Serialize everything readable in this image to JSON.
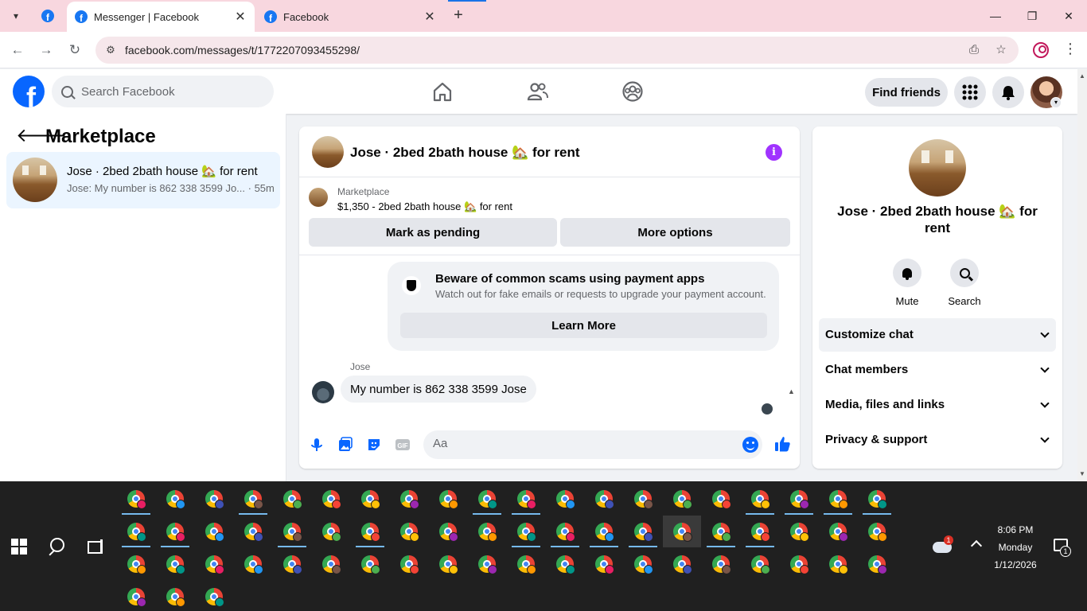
{
  "browser": {
    "tabs": [
      {
        "title": "Messenger | Facebook",
        "active": true
      },
      {
        "title": "Facebook",
        "active": false
      }
    ],
    "url": "facebook.com/messages/t/1772207093455298/"
  },
  "header": {
    "search_placeholder": "Search Facebook",
    "find_friends": "Find friends"
  },
  "sidebar": {
    "title": "Marketplace",
    "conversations": [
      {
        "name": "Jose · 2bed 2bath house 🏡 for rent",
        "snippet": "Jose: My number is 862 338 3599 Jo... · 55m"
      }
    ]
  },
  "chat": {
    "title": "Jose · 2bed 2bath house 🏡 for rent",
    "listing_label": "Marketplace",
    "listing_desc": "$1,350 - 2bed 2bath house 🏡 for rent",
    "mark_pending": "Mark as pending",
    "more_options": "More options",
    "scam_title": "Beware of common scams using payment apps",
    "scam_sub": "Watch out for fake emails or requests to upgrade your payment account.",
    "learn_more": "Learn More",
    "sender": "Jose",
    "message": "My number is 862 338 3599 Jose",
    "composer_placeholder": "Aa"
  },
  "info_panel": {
    "title": "Jose · 2bed 2bath house 🏡 for rent",
    "mute": "Mute",
    "search": "Search",
    "sections": [
      "Customize chat",
      "Chat members",
      "Media, files and links",
      "Privacy & support"
    ]
  },
  "taskbar": {
    "time": "8:06 PM",
    "day": "Monday",
    "date": "1/12/2026",
    "notification_count": "1",
    "weather_badge": "1",
    "icon_names": [
      "windows-start-icon",
      "search-icon",
      "task-view-icon",
      "chrome-icon",
      "weather-icon",
      "notification-icon"
    ]
  },
  "colors": {
    "facebook_blue": "#0866ff",
    "tab_strip": "#f8d7df",
    "taskbar": "#202020",
    "info_purple": "#a033ff"
  }
}
